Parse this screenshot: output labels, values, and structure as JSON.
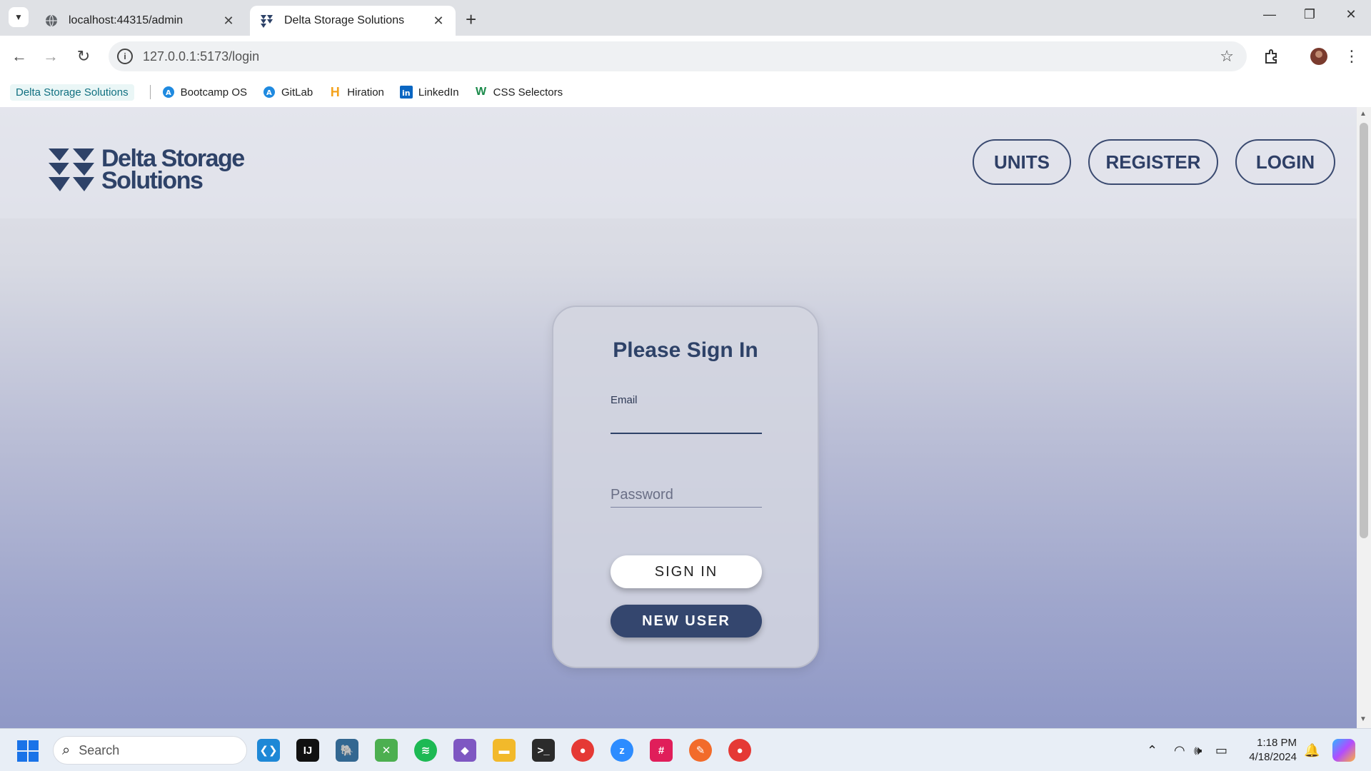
{
  "browser": {
    "tabs": [
      {
        "title": "localhost:44315/admin",
        "icon": "globe-icon"
      },
      {
        "title": "Delta Storage Solutions",
        "icon": "delta-logo-icon"
      }
    ],
    "url": "127.0.0.1:5173/login",
    "bookmarks": [
      {
        "label": "Delta Storage Solutions"
      },
      {
        "label": "Bootcamp OS",
        "icon": "bootcamp-icon"
      },
      {
        "label": "GitLab",
        "icon": "gitlab-icon"
      },
      {
        "label": "Hiration",
        "icon": "hiration-icon"
      },
      {
        "label": "LinkedIn",
        "icon": "linkedin-icon"
      },
      {
        "label": "CSS Selectors",
        "icon": "css-selectors-icon"
      }
    ]
  },
  "site": {
    "logo_line1": "Delta Storage",
    "logo_line2": "Solutions",
    "nav": {
      "units": "UNITS",
      "register": "REGISTER",
      "login": "LOGIN"
    }
  },
  "login": {
    "title": "Please Sign In",
    "email_label": "Email",
    "email_value": "",
    "password_placeholder": "Password",
    "sign_in": "SIGN IN",
    "new_user": "NEW USER"
  },
  "taskbar": {
    "search_placeholder": "Search",
    "time": "1:18 PM",
    "date": "4/18/2024"
  },
  "colors": {
    "brand_navy": "#2e4268",
    "button_dark": "#34466e",
    "page_gradient_top": "#e4e5ea",
    "page_gradient_bottom": "#8f98c6"
  }
}
